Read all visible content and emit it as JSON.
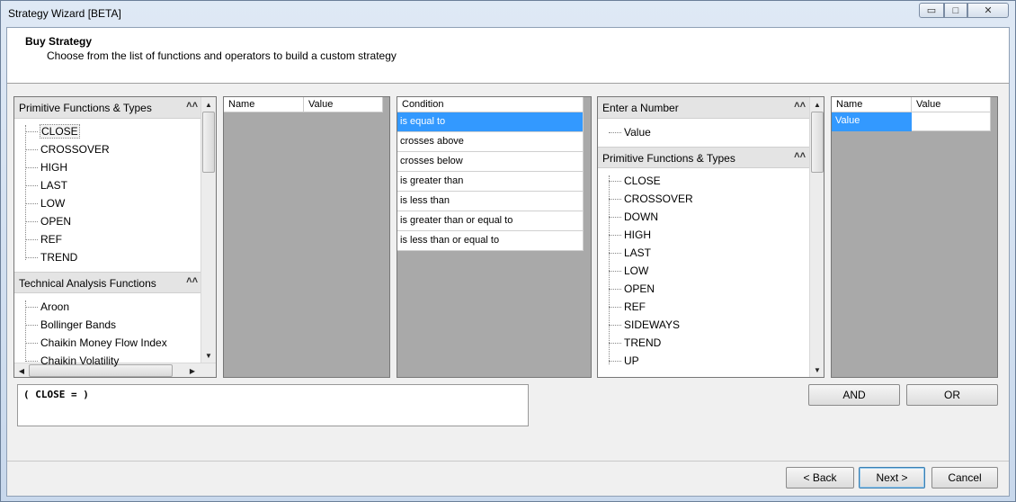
{
  "window": {
    "title": "Strategy Wizard [BETA]",
    "controls": {
      "minimize": "▭",
      "maximize": "□",
      "close": "✕"
    }
  },
  "header": {
    "title": "Buy Strategy",
    "subtitle": "Choose from the list of functions and operators to build a custom strategy"
  },
  "left_panel": {
    "primitive_header": "Primitive Functions & Types",
    "primitive_items": [
      "CLOSE",
      "CROSSOVER",
      "HIGH",
      "LAST",
      "LOW",
      "OPEN",
      "REF",
      "TREND"
    ],
    "selected_item": "CLOSE",
    "ta_header": "Technical Analysis Functions",
    "ta_items": [
      "Aroon",
      "Bollinger Bands",
      "Chaikin Money Flow Index",
      "Chaikin Volatility"
    ]
  },
  "param_grid_1": {
    "col_name": "Name",
    "col_value": "Value"
  },
  "condition_list": {
    "header": "Condition",
    "items": [
      "is equal to",
      "crosses above",
      "crosses below",
      "is greater than",
      "is less than",
      "is greater than or equal to",
      "is less than or equal to"
    ],
    "selected_index": 0
  },
  "right_panel": {
    "number_header": "Enter a Number",
    "number_items": [
      "Value"
    ],
    "primitive_header": "Primitive Functions & Types",
    "primitive_items": [
      "CLOSE",
      "CROSSOVER",
      "DOWN",
      "HIGH",
      "LAST",
      "LOW",
      "OPEN",
      "REF",
      "SIDEWAYS",
      "TREND",
      "UP"
    ]
  },
  "param_grid_2": {
    "col_name": "Name",
    "col_value": "Value",
    "rows": [
      {
        "name": "Value",
        "value": ""
      }
    ]
  },
  "expression": "( CLOSE = )",
  "buttons": {
    "and": "AND",
    "or": "OR",
    "back": "< Back",
    "next": "Next >",
    "cancel": "Cancel"
  },
  "colors": {
    "selection": "#3399ff",
    "panel_gray": "#a9a9a9"
  },
  "icons": {
    "collapse": "chevron-double-up-icon",
    "scroll_up": "triangle-up-icon",
    "scroll_down": "triangle-down-icon"
  }
}
